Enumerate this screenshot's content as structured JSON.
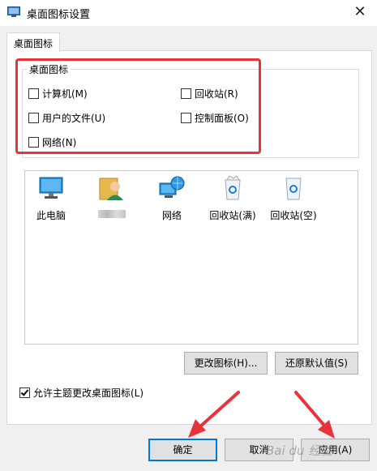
{
  "window": {
    "title": "桌面图标设置"
  },
  "tabs": [
    {
      "label": "桌面图标"
    }
  ],
  "group": {
    "legend": "桌面图标",
    "checkboxes": [
      {
        "label": "计算机(M)",
        "checked": false
      },
      {
        "label": "回收站(R)",
        "checked": false
      },
      {
        "label": "用户的文件(U)",
        "checked": false
      },
      {
        "label": "控制面板(O)",
        "checked": false
      },
      {
        "label": "网络(N)",
        "checked": false
      }
    ]
  },
  "icons": [
    {
      "label": "此电脑",
      "icon": "computer-icon"
    },
    {
      "label": "",
      "icon": "user-folder-icon",
      "label_blurred": true
    },
    {
      "label": "网络",
      "icon": "network-icon"
    },
    {
      "label": "回收站(满)",
      "icon": "recycle-bin-full-icon"
    },
    {
      "label": "回收站(空)",
      "icon": "recycle-bin-empty-icon"
    }
  ],
  "buttons": {
    "change_icon": "更改图标(H)...",
    "restore_default": "还原默认值(S)",
    "ok": "确定",
    "cancel": "取消",
    "apply": "应用(A)"
  },
  "theme_checkbox": {
    "label": "允许主题更改桌面图标(L)",
    "checked": true
  },
  "watermark": "Bai du 经验",
  "colors": {
    "highlight": "#e8323c",
    "focus_border": "#0078d7",
    "arrow": "#e8323c"
  }
}
